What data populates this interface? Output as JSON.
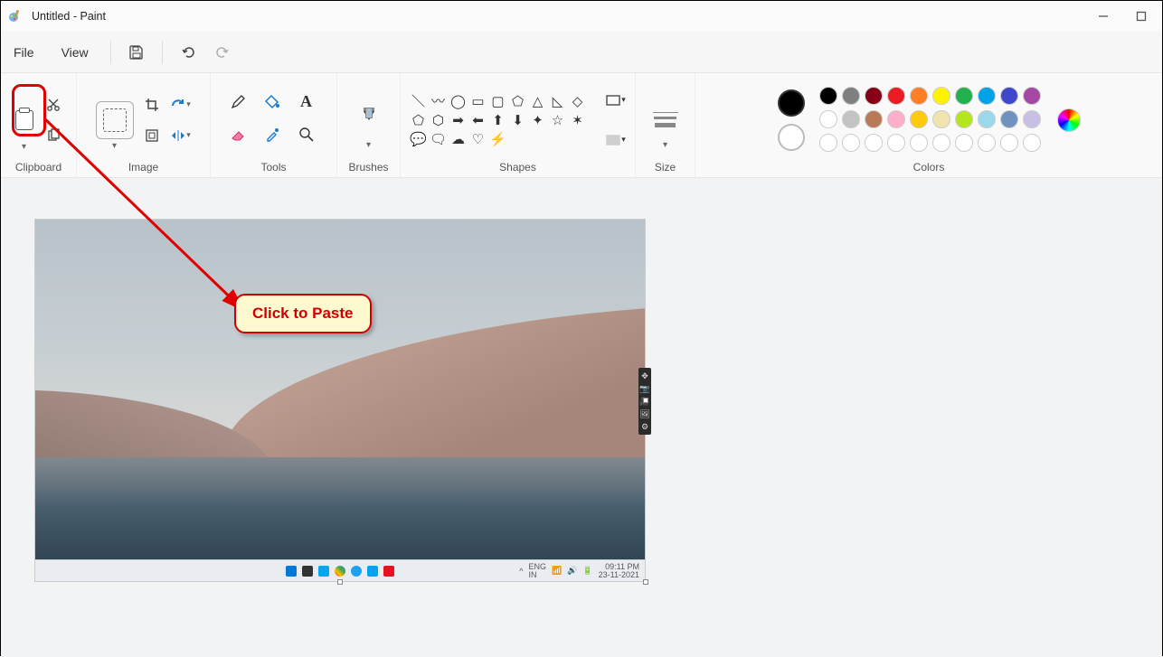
{
  "titlebar": {
    "title": "Untitled - Paint"
  },
  "menu": {
    "file": "File",
    "view": "View"
  },
  "ribbon": {
    "clipboard_label": "Clipboard",
    "image_label": "Image",
    "tools_label": "Tools",
    "brushes_label": "Brushes",
    "shapes_label": "Shapes",
    "size_label": "Size",
    "colors_label": "Colors"
  },
  "colors": {
    "color1": "#000000",
    "color2": "#ffffff",
    "row1": [
      "#000000",
      "#7f7f7f",
      "#880015",
      "#ed1c24",
      "#ff7f27",
      "#fff200",
      "#22b14c",
      "#00a2e8",
      "#3f48cc",
      "#a349a4"
    ],
    "row2": [
      "#ffffff",
      "#c3c3c3",
      "#b97a57",
      "#ffaec9",
      "#ffc90e",
      "#efe4b0",
      "#b5e61d",
      "#99d9ea",
      "#7092be",
      "#c8bfe7"
    ],
    "row3": [
      "#ffffff",
      "#ffffff",
      "#ffffff",
      "#ffffff",
      "#ffffff",
      "#ffffff",
      "#ffffff",
      "#ffffff",
      "#ffffff",
      "#ffffff"
    ]
  },
  "annotation": {
    "callout": "Click to Paste"
  },
  "taskbar": {
    "lang1": "ENG",
    "lang2": "IN",
    "time": "09:11 PM",
    "date": "23-11-2021"
  }
}
